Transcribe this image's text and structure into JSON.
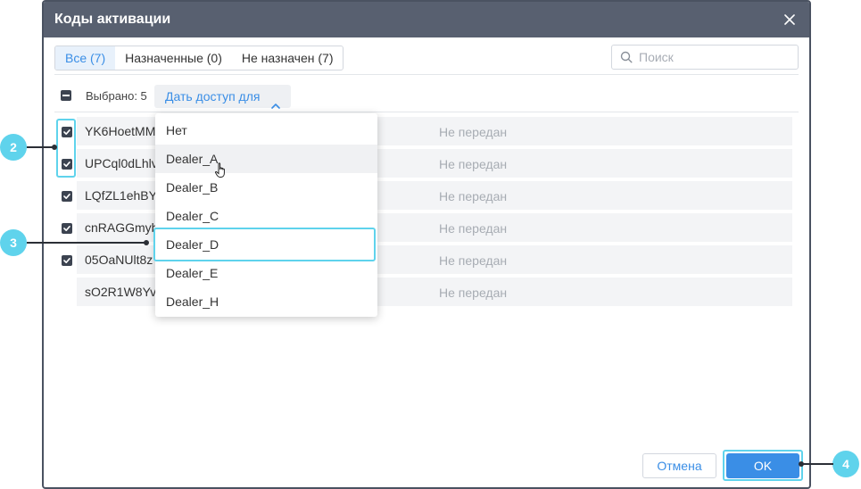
{
  "dialog": {
    "title": "Коды активации"
  },
  "tabs": [
    {
      "label": "Все (7)",
      "active": true
    },
    {
      "label": "Назначенные (0)",
      "active": false
    },
    {
      "label": "Не назначен (7)",
      "active": false
    }
  ],
  "search": {
    "placeholder": "Поиск"
  },
  "selection": {
    "label": "Выбрано: 5",
    "access_button": "Дать доступ для"
  },
  "rows": [
    {
      "code": "YK6HoetMM",
      "status": "Не передан",
      "checked": true
    },
    {
      "code": "UPCql0dLhlv",
      "status": "Не передан",
      "checked": true
    },
    {
      "code": "LQfZL1ehBY",
      "status": "Не передан",
      "checked": true
    },
    {
      "code": "cnRAGGmyb",
      "status": "Не передан",
      "checked": true
    },
    {
      "code": "05OaNUlt8z",
      "status": "Не передан",
      "checked": true
    },
    {
      "code": "sO2R1W8Yv",
      "status": "Не передан",
      "checked": false
    }
  ],
  "dropdown": {
    "items": [
      "Нет",
      "Dealer_A",
      "Dealer_B",
      "Dealer_C",
      "Dealer_D",
      "Dealer_E",
      "Dealer_H"
    ]
  },
  "footer": {
    "cancel": "Отмена",
    "ok": "OK"
  },
  "callouts": [
    "2",
    "3",
    "4"
  ],
  "colors": {
    "titlebar": "#586070",
    "accent": "#3a8ee6",
    "highlight": "#5fd3ec",
    "row_bg": "#f3f4f6",
    "status_text": "#a7acb3"
  }
}
